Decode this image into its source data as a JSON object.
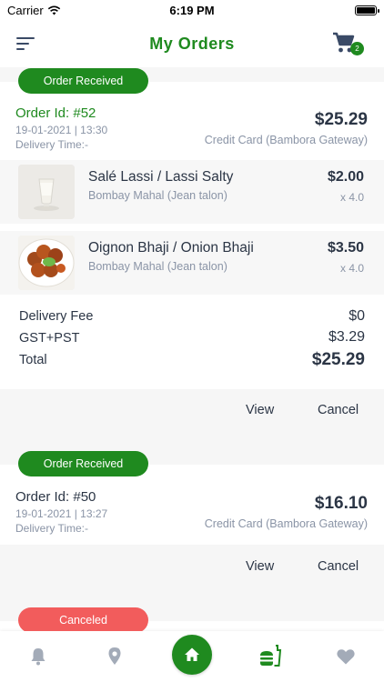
{
  "status_bar": {
    "carrier": "Carrier",
    "time": "6:19 PM"
  },
  "header": {
    "title": "My Orders",
    "cart_count": "2"
  },
  "orders": [
    {
      "status": "Order Received",
      "status_color": "#1f8a1f",
      "order_id": "Order Id: #52",
      "date": "19-01-2021 | 13:30",
      "delivery_time": "Delivery Time:-",
      "total": "$25.29",
      "payment": "Credit Card (Bambora Gateway)",
      "items": [
        {
          "name": "Salé Lassi / Lassi Salty",
          "restaurant": "Bombay Mahal (Jean talon)",
          "price": "$2.00",
          "qty": "x 4.0",
          "image": "lassi-glass"
        },
        {
          "name": "Oignon Bhaji / Onion Bhaji",
          "restaurant": "Bombay Mahal (Jean talon)",
          "price": "$3.50",
          "qty": "x 4.0",
          "image": "onion-bhaji-plate"
        }
      ],
      "summary": {
        "delivery_fee_label": "Delivery Fee",
        "delivery_fee": "$0",
        "tax_label": "GST+PST",
        "tax": "$3.29",
        "total_label": "Total",
        "total": "$25.29"
      },
      "actions": {
        "view": "View",
        "cancel": "Cancel"
      }
    },
    {
      "status": "Order Received",
      "status_color": "#1f8a1f",
      "order_id": "Order Id: #50",
      "date": "19-01-2021 | 13:27",
      "delivery_time": "Delivery Time:-",
      "total": "$16.10",
      "payment": "Credit Card (Bambora Gateway)",
      "actions": {
        "view": "View",
        "cancel": "Cancel"
      }
    },
    {
      "status": "Canceled",
      "status_color": "#f25c5c"
    }
  ],
  "tab_bar": {
    "tabs": [
      "bell-icon",
      "location-pin-icon",
      "home-icon",
      "fast-food-icon",
      "heart-icon"
    ],
    "active_tab": "home-icon",
    "accent": "#1f8a1f"
  }
}
